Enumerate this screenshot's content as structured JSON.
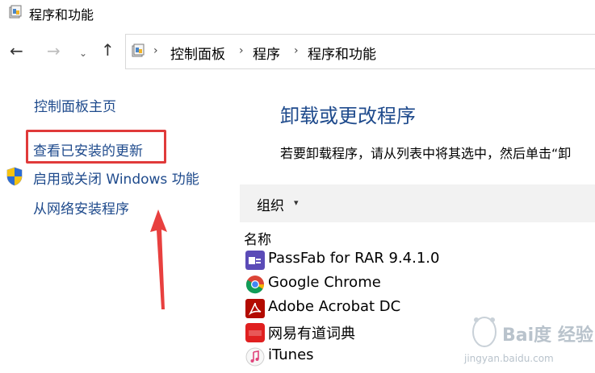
{
  "window": {
    "title": "程序和功能"
  },
  "nav": {
    "back": "←",
    "forward": "→",
    "recent": "⌄",
    "up": "↑"
  },
  "breadcrumb": {
    "items": [
      "控制面板",
      "程序",
      "程序和功能"
    ],
    "separator": "›"
  },
  "sidebar": {
    "home": "控制面板主页",
    "view_updates": "查看已安装的更新",
    "toggle_features": "启用或关闭 Windows 功能",
    "install_network": "从网络安装程序"
  },
  "main": {
    "heading": "卸载或更改程序",
    "instruction": "若要卸载程序，请从列表中将其选中，然后单击“卸",
    "toolbar": {
      "organize": "组织",
      "caret": "▾"
    },
    "column_name": "名称",
    "programs": [
      {
        "name": "PassFab for RAR 9.4.1.0",
        "icon": "passfab-icon"
      },
      {
        "name": "Google Chrome",
        "icon": "chrome-icon"
      },
      {
        "name": "Adobe Acrobat DC",
        "icon": "acrobat-icon"
      },
      {
        "name": "网易有道词典",
        "icon": "youdao-icon"
      },
      {
        "name": "iTunes",
        "icon": "itunes-icon"
      }
    ]
  },
  "watermark": {
    "brand": "Bai度 经验",
    "url": "jingyan.baidu.com"
  },
  "colors": {
    "link": "#1e4a8c",
    "highlight": "#e03a3a",
    "toolbar_bg": "#f2f2f2"
  }
}
